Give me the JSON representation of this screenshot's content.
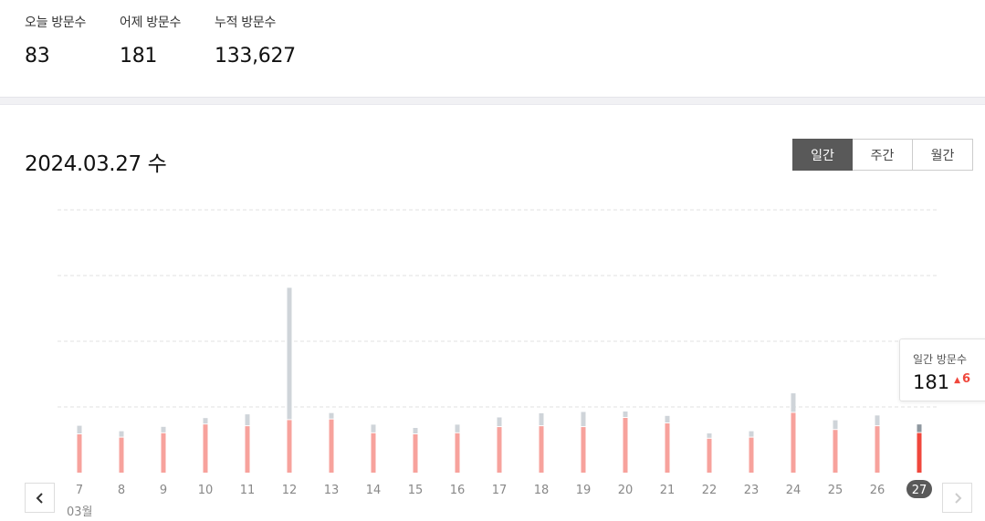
{
  "stats": {
    "today": {
      "label": "오늘 방문수",
      "value": "83"
    },
    "yesterday": {
      "label": "어제 방문수",
      "value": "181"
    },
    "total": {
      "label": "누적 방문수",
      "value": "133,627"
    }
  },
  "date_title": "2024.03.27 수",
  "period_tabs": [
    "일간",
    "주간",
    "월간"
  ],
  "active_tab": "일간",
  "month_label": "03월",
  "tooltip": {
    "label": "일간 방문수",
    "value": "181",
    "diff": "6"
  },
  "colors": {
    "accent": "#f0473c",
    "bar": "#f7a29c",
    "bar_selected": "#f0473c",
    "bar_other": "#cfd4d9",
    "bar_other_selected": "#8e979f",
    "tab_active": "#595959"
  },
  "icons": {
    "prev": "chevron-left-icon",
    "next": "chevron-right-icon",
    "up": "triangle-up-icon"
  },
  "chart_data": {
    "type": "bar",
    "stacked": true,
    "categories": [
      "7",
      "8",
      "9",
      "10",
      "11",
      "12",
      "13",
      "14",
      "15",
      "16",
      "17",
      "18",
      "19",
      "20",
      "21",
      "22",
      "23",
      "24",
      "25",
      "26",
      "27"
    ],
    "series": [
      {
        "values": [
          175,
          160,
          180,
          220,
          212,
          240,
          243,
          180,
          175,
          180,
          208,
          212,
          208,
          250,
          225,
          155,
          160,
          273,
          195,
          212,
          181
        ]
      },
      {
        "values": [
          35,
          25,
          25,
          25,
          50,
          600,
          25,
          35,
          25,
          35,
          40,
          55,
          65,
          25,
          30,
          20,
          25,
          85,
          40,
          45,
          35
        ]
      }
    ],
    "selected": "27",
    "ylim": [
      0,
      1200
    ],
    "grid": true
  }
}
